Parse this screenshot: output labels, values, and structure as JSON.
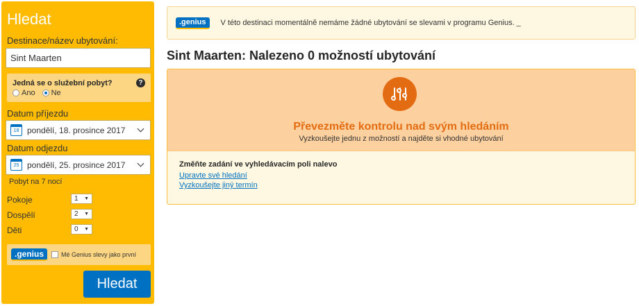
{
  "sidebar": {
    "title": "Hledat",
    "destination_label": "Destinace/název ubytování:",
    "destination_value": "Sint Maarten",
    "business_question": "Jedná se o služební pobyt?",
    "help_glyph": "?",
    "radio_yes": "Ano",
    "radio_no": "Ne",
    "checkin_label": "Datum příjezdu",
    "checkin_value": "pondělí, 18. prosince 2017",
    "checkin_day": "18",
    "checkout_label": "Datum odjezdu",
    "checkout_value": "pondělí, 25. prosince 2017",
    "checkout_day": "25",
    "stay_length": "Pobyt na 7 nocí",
    "rooms_label": "Pokoje",
    "rooms_value": "1",
    "adults_label": "Dospělí",
    "adults_value": "2",
    "children_label": "Děti",
    "children_value": "0",
    "genius_logo": ".genius",
    "genius_checkbox_label": "Mé Genius slevy jako první",
    "search_button": "Hledat"
  },
  "banner": {
    "logo": ".genius",
    "text": "V této destinaci momentálně nemáme žádné ubytování se slevami v programu Genius. _"
  },
  "results": {
    "title": "Sint Maarten: Nalezeno 0 možností ubytování"
  },
  "panel": {
    "heading": "Převezměte kontrolu nad svým hledáním",
    "subheading": "Vyzkoušejte jednu z možností a najděte si vhodné ubytování",
    "tips_heading": "Změňte zadání ve vyhledávacím poli nalevo",
    "link_edit": "Upravte své hledání",
    "link_dates": "Vyzkoušejte jiný termín"
  },
  "colors": {
    "sidebar_bg": "#febb02",
    "brand_blue": "#0071c2",
    "accent_orange": "#e36c12"
  }
}
